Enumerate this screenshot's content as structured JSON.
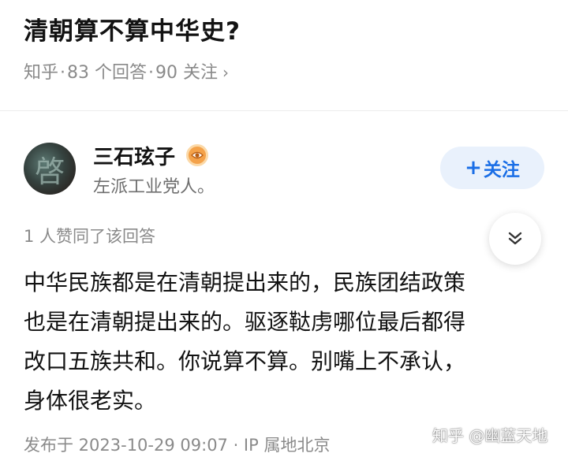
{
  "question": {
    "title": "清朝算不算中华史?",
    "meta": {
      "site": "知乎",
      "separator": "·",
      "answers": "83 个回答",
      "followers": "90 关注",
      "chevron": "›"
    }
  },
  "answer": {
    "author": {
      "name": "三石玹子",
      "bio": "左派工业党人。",
      "avatar_icon": "avatar-image",
      "avatar_glyph": "啓",
      "badge_icon": "eye-badge-icon"
    },
    "follow_button": {
      "plus": "+",
      "label": "关注"
    },
    "likes_text": "1 人赞同了该回答",
    "collapse_icon": "double-chevron-down-icon",
    "content_lines": [
      "中华民族都是在清朝提出来的，民族团结政策",
      "也是在清朝提出来的。驱逐鞑虏哪位最后都得",
      "改口五族共和。你说算不算。别嘴上不承认，",
      "身体很老实。"
    ],
    "footer": "发布于 2023-10-29 09:07 · IP 属地北京"
  },
  "watermark": "知乎 @幽蓝天地",
  "colors": {
    "accent": "#1a6ee6",
    "follow_bg": "#e9f1fc",
    "muted": "#8a8a8a",
    "badge": "#f4a24a"
  }
}
